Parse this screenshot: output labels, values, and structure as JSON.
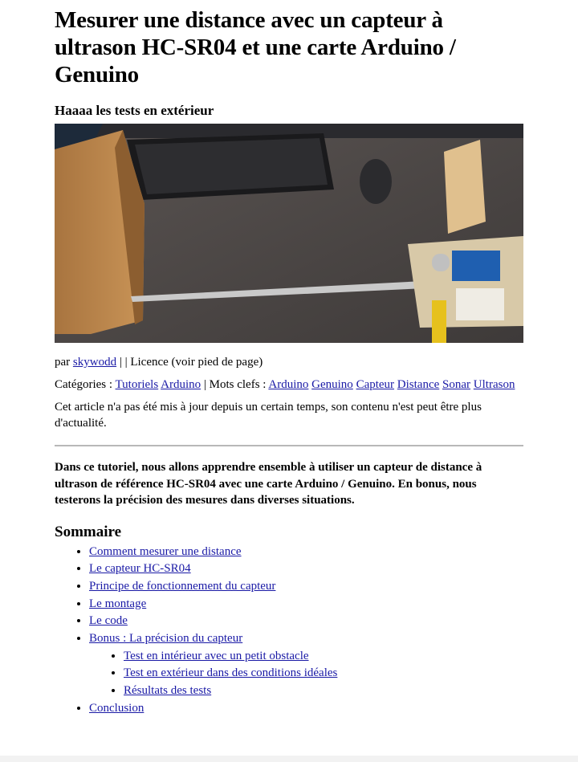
{
  "article": {
    "title": "Mesurer une distance avec un capteur à ultrason HC-SR04 et une carte Arduino / Genuino",
    "subtitle": "Haaaa les tests en extérieur",
    "byline": {
      "prefix": "par ",
      "author": "skywodd",
      "suffix": " | | Licence (voir pied de page)"
    },
    "categories": {
      "label": "Catégories : ",
      "items": [
        "Tutoriels",
        "Arduino"
      ],
      "tags_label": " | Mots clefs : ",
      "tags": [
        "Arduino",
        "Genuino",
        "Capteur",
        "Distance",
        "Sonar",
        "Ultrason"
      ]
    },
    "notice": "Cet article n'a pas été mis à jour depuis un certain temps, son contenu n'est peut être plus d'actualité.",
    "intro": "Dans ce tutoriel, nous allons apprendre ensemble à utiliser un capteur de distance à ultrason de référence HC-SR04 avec une carte Arduino / Genuino. En bonus, nous testerons la précision des mesures dans diverses situations."
  },
  "toc": {
    "title": "Sommaire",
    "items": [
      "Comment mesurer une distance",
      "Le capteur HC-SR04",
      "Principe de fonctionnement du capteur",
      "Le montage",
      "Le code",
      "Bonus : La précision du capteur"
    ],
    "sub_items": [
      "Test en intérieur avec un petit obstacle",
      "Test en extérieur dans des conditions idéales",
      "Résultats des tests"
    ],
    "last_item": "Conclusion"
  }
}
